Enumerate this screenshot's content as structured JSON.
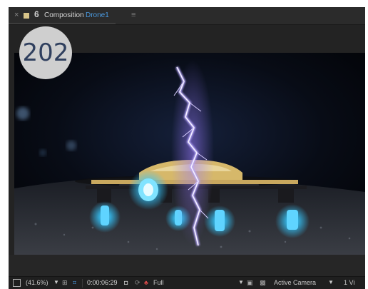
{
  "badge": "202",
  "tab": {
    "close_glyph": "×",
    "lock_glyph": "6",
    "title": "Composition",
    "comp_name": "Drone1",
    "menu_glyph": "≡"
  },
  "footer": {
    "zoom": "(41.6%)",
    "timecode": "0:00:06:29",
    "resolution": "Full",
    "view": "Active Camera",
    "views": "1 Vi"
  },
  "icons": [
    "close-icon",
    "color-swatch-icon",
    "lock-icon",
    "panel-menu-icon",
    "region-of-interest-icon",
    "grid-icon",
    "transparency-grid-icon",
    "camera-icon",
    "snapshot-icon",
    "color-channels-icon",
    "fast-preview-icon",
    "toggle-transparency-icon"
  ]
}
